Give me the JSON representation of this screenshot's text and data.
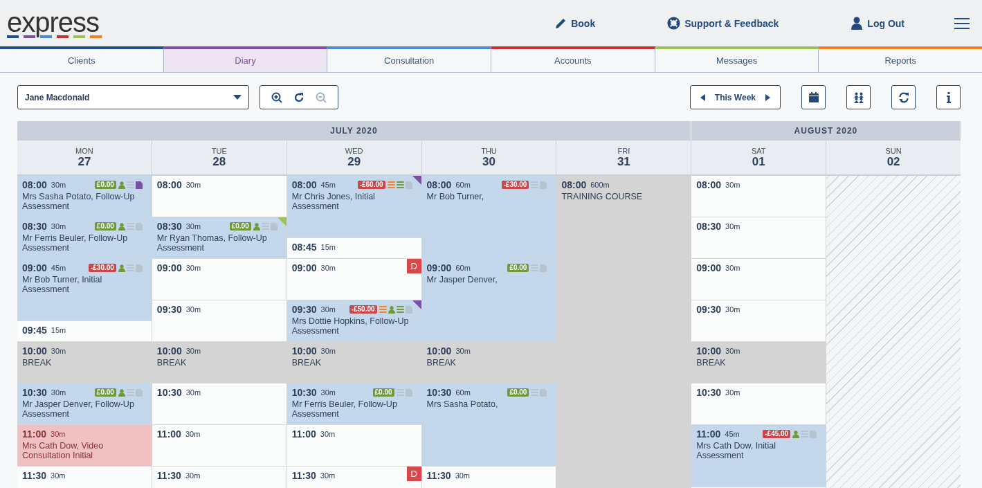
{
  "header": {
    "logo": "express",
    "nav": [
      {
        "kind": "book",
        "label": "Book"
      },
      {
        "kind": "support",
        "label": "Support & Feedback"
      },
      {
        "kind": "logout",
        "label": "Log Out"
      }
    ]
  },
  "tabs": [
    {
      "label": "Clients",
      "color": "#1f4e8c",
      "selected": false
    },
    {
      "label": "Diary",
      "color": "#7b4fa3",
      "selected": true
    },
    {
      "label": "Consultation",
      "color": "#4f8ad1",
      "selected": false
    },
    {
      "label": "Accounts",
      "color": "#c53030",
      "selected": false
    },
    {
      "label": "Messages",
      "color": "#9bc454",
      "selected": false
    },
    {
      "label": "Reports",
      "color": "#f2841f",
      "selected": false
    }
  ],
  "toolbar": {
    "practitioner": "Jane Macdonald",
    "zoom_out_disabled": true,
    "week_label": "This Week"
  },
  "diary": {
    "months": [
      {
        "label": "JULY 2020",
        "days": [
          {
            "dow": "MON",
            "date": "27",
            "unavailable": false,
            "slots": [
              {
                "kind": "appointment",
                "time": "08:00",
                "duration": "30m",
                "title": "Mrs Sasha Potato, Follow-Up Assessment",
                "balance": {
                  "text": "£0.00",
                  "color": "#6e9a3a"
                },
                "icons": [
                  {
                    "kind": "person",
                    "color": "#6e9a3a"
                  },
                  {
                    "kind": "stack",
                    "color": "#b8c3d0"
                  },
                  {
                    "kind": "note",
                    "color": "#7b4fa3"
                  }
                ]
              },
              {
                "kind": "appointment",
                "time": "08:30",
                "duration": "30m",
                "title": "Mr Ferris Beuler, Follow-Up Assessment",
                "balance": {
                  "text": "£0.00",
                  "color": "#6e9a3a"
                },
                "icons": [
                  {
                    "kind": "person",
                    "color": "#6e9a3a"
                  },
                  {
                    "kind": "stack",
                    "color": "#b8c3d0"
                  },
                  {
                    "kind": "note",
                    "color": "#b8c3d0"
                  }
                ]
              },
              {
                "kind": "appointment",
                "time": "09:00",
                "duration": "45m",
                "title": "Mr Bob Turner, Initial Assessment",
                "balance": {
                  "text": "-£30.00",
                  "color": "#c9474b"
                },
                "icons": [
                  {
                    "kind": "person",
                    "color": "#6e9a3a"
                  },
                  {
                    "kind": "stack",
                    "color": "#b8c3d0"
                  },
                  {
                    "kind": "note",
                    "color": "#b8c3d0"
                  }
                ]
              },
              {
                "kind": "free",
                "time": "09:45",
                "duration": "15m"
              },
              {
                "kind": "break",
                "time": "10:00",
                "duration": "30m",
                "title": "BREAK"
              },
              {
                "kind": "appointment",
                "time": "10:30",
                "duration": "30m",
                "title": "Mr Jasper Denver, Follow-Up Assessment",
                "balance": {
                  "text": "£0.00",
                  "color": "#6e9a3a"
                },
                "icons": [
                  {
                    "kind": "person",
                    "color": "#6e9a3a"
                  },
                  {
                    "kind": "stack",
                    "color": "#b8c3d0"
                  },
                  {
                    "kind": "note",
                    "color": "#b8c3d0"
                  }
                ]
              },
              {
                "kind": "video",
                "time": "11:00",
                "duration": "30m",
                "title": "Mrs Cath Dow, Video Consultation Initial"
              },
              {
                "kind": "free",
                "time": "11:30",
                "duration": "30m"
              }
            ]
          },
          {
            "dow": "TUE",
            "date": "28",
            "unavailable": false,
            "slots": [
              {
                "kind": "free",
                "time": "08:00",
                "duration": "30m"
              },
              {
                "kind": "appointment",
                "time": "08:30",
                "duration": "30m",
                "title": "Mr Ryan Thomas, Follow-Up Assessment",
                "flag": {
                  "color": "#9bc454"
                },
                "balance": {
                  "text": "£0.00",
                  "color": "#6e9a3a"
                },
                "icons": [
                  {
                    "kind": "person",
                    "color": "#6e9a3a"
                  },
                  {
                    "kind": "stack",
                    "color": "#b8c3d0"
                  },
                  {
                    "kind": "note",
                    "color": "#b8c3d0"
                  }
                ]
              },
              {
                "kind": "free",
                "time": "09:00",
                "duration": "30m"
              },
              {
                "kind": "free",
                "time": "09:30",
                "duration": "30m"
              },
              {
                "kind": "break",
                "time": "10:00",
                "duration": "30m",
                "title": "BREAK"
              },
              {
                "kind": "free",
                "time": "10:30",
                "duration": "30m"
              },
              {
                "kind": "free",
                "time": "11:00",
                "duration": "30m"
              },
              {
                "kind": "free",
                "time": "11:30",
                "duration": "30m"
              }
            ]
          },
          {
            "dow": "WED",
            "date": "29",
            "unavailable": false,
            "slots": [
              {
                "kind": "appointment",
                "time": "08:00",
                "duration": "45m",
                "title": "Mr Chris Jones, Initial Assessment",
                "flag": {
                  "color": "#7b4fa3"
                },
                "balance": {
                  "text": "-£60.00",
                  "color": "#c9474b"
                },
                "icons": [
                  {
                    "kind": "stack",
                    "color": "#f2841f"
                  },
                  {
                    "kind": "stack",
                    "color": "#6e9a3a"
                  },
                  {
                    "kind": "note",
                    "color": "#b8c3d0"
                  }
                ]
              },
              {
                "kind": "free",
                "time": "08:45",
                "duration": "15m"
              },
              {
                "kind": "free",
                "time": "09:00",
                "duration": "30m",
                "marker": "D"
              },
              {
                "kind": "appointment",
                "time": "09:30",
                "duration": "30m",
                "title": "Mrs Dottie Hopkins, Follow-Up Assessment",
                "flag": {
                  "color": "#7b4fa3"
                },
                "balance": {
                  "text": "-£50.00",
                  "color": "#c9474b"
                },
                "icons": [
                  {
                    "kind": "stack",
                    "color": "#f2841f"
                  },
                  {
                    "kind": "person",
                    "color": "#6e9a3a"
                  },
                  {
                    "kind": "stack",
                    "color": "#6e9a3a"
                  },
                  {
                    "kind": "note",
                    "color": "#b8c3d0"
                  }
                ]
              },
              {
                "kind": "break",
                "time": "10:00",
                "duration": "30m",
                "title": "BREAK"
              },
              {
                "kind": "appointment",
                "time": "10:30",
                "duration": "30m",
                "title": "Mr Ferris Beuler, Follow-Up Assessment",
                "balance": {
                  "text": "£0.00",
                  "color": "#6e9a3a"
                },
                "icons": [
                  {
                    "kind": "stack",
                    "color": "#b8c3d0"
                  },
                  {
                    "kind": "note",
                    "color": "#b8c3d0"
                  }
                ]
              },
              {
                "kind": "free",
                "time": "11:00",
                "duration": "30m"
              },
              {
                "kind": "free",
                "time": "11:30",
                "duration": "30m",
                "marker": "D"
              }
            ]
          },
          {
            "dow": "THU",
            "date": "30",
            "unavailable": false,
            "slots": [
              {
                "kind": "appointment",
                "time": "08:00",
                "duration": "60m",
                "title": "Mr Bob Turner,",
                "balance": {
                  "text": "-£30.00",
                  "color": "#c9474b"
                },
                "icons": [
                  {
                    "kind": "stack",
                    "color": "#b8c3d0"
                  },
                  {
                    "kind": "note",
                    "color": "#b8c3d0"
                  }
                ]
              },
              {
                "kind": "appointment",
                "time": "09:00",
                "duration": "60m",
                "title": "Mr Jasper Denver,",
                "balance": {
                  "text": "£0.00",
                  "color": "#6e9a3a"
                },
                "icons": [
                  {
                    "kind": "stack",
                    "color": "#b8c3d0"
                  },
                  {
                    "kind": "note",
                    "color": "#b8c3d0"
                  }
                ]
              },
              {
                "kind": "break",
                "time": "10:00",
                "duration": "30m",
                "title": "BREAK"
              },
              {
                "kind": "appointment",
                "time": "10:30",
                "duration": "60m",
                "title": "Mrs Sasha Potato,",
                "balance": {
                  "text": "£0.00",
                  "color": "#6e9a3a"
                },
                "icons": [
                  {
                    "kind": "stack",
                    "color": "#b8c3d0"
                  },
                  {
                    "kind": "note",
                    "color": "#b8c3d0"
                  }
                ]
              },
              {
                "kind": "free",
                "time": "11:30",
                "duration": "30m"
              }
            ]
          },
          {
            "dow": "FRI",
            "date": "31",
            "unavailable": false,
            "slots": [
              {
                "kind": "course",
                "time": "08:00",
                "duration": "600m",
                "title": "TRAINING COURSE"
              }
            ]
          }
        ]
      },
      {
        "label": "AUGUST 2020",
        "days": [
          {
            "dow": "SAT",
            "date": "01",
            "unavailable": false,
            "slots": [
              {
                "kind": "free",
                "time": "08:00",
                "duration": "30m"
              },
              {
                "kind": "free",
                "time": "08:30",
                "duration": "30m"
              },
              {
                "kind": "free",
                "time": "09:00",
                "duration": "30m"
              },
              {
                "kind": "free",
                "time": "09:30",
                "duration": "30m"
              },
              {
                "kind": "break",
                "time": "10:00",
                "duration": "30m",
                "title": "BREAK"
              },
              {
                "kind": "free",
                "time": "10:30",
                "duration": "30m"
              },
              {
                "kind": "appointment",
                "time": "11:00",
                "duration": "45m",
                "title": "Mrs Cath Dow, Initial Assessment",
                "balance": {
                  "text": "-£45.00",
                  "color": "#c9474b"
                },
                "icons": [
                  {
                    "kind": "person",
                    "color": "#6e9a3a"
                  },
                  {
                    "kind": "stack",
                    "color": "#b8c3d0"
                  },
                  {
                    "kind": "note",
                    "color": "#b8c3d0"
                  }
                ]
              }
            ]
          },
          {
            "dow": "SUN",
            "date": "02",
            "unavailable": true
          }
        ]
      }
    ]
  }
}
